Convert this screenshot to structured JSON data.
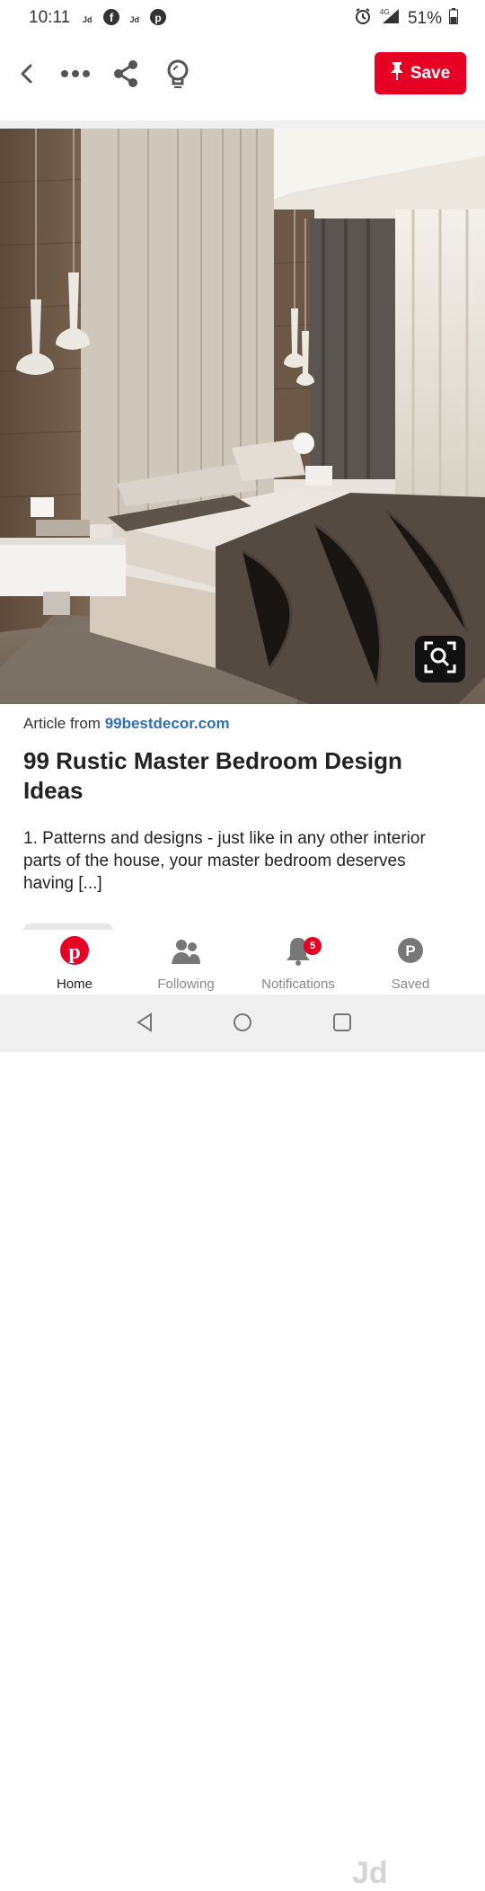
{
  "status": {
    "time": "10:11",
    "mini_labels": [
      "Jd",
      "Jd"
    ],
    "battery": "51%",
    "network": "4G",
    "icons": [
      "facebook-icon",
      "pinterest-icon",
      "alarm-icon",
      "signal-icon",
      "battery-icon"
    ]
  },
  "toolbar": {
    "save_label": "Save",
    "icons": [
      "back-arrow-icon",
      "more-icon",
      "share-icon",
      "visual-search-icon",
      "pin-icon"
    ]
  },
  "article": {
    "source_prefix": "Article from ",
    "source_domain": "99bestdecor.com",
    "title": "99 Rustic Master Bedroom Design Ideas",
    "description": "1. Patterns and designs - just like in any other interior parts of the house, your master bedroom deserves having [...]"
  },
  "nav": {
    "items": [
      {
        "label": "Home",
        "icon": "pinterest-logo-icon",
        "active": true
      },
      {
        "label": "Following",
        "icon": "people-icon",
        "active": false
      },
      {
        "label": "Notifications",
        "icon": "bell-icon",
        "active": false,
        "badge": "5"
      },
      {
        "label": "Saved",
        "icon": "profile-icon",
        "active": false,
        "avatar_letter": "P"
      }
    ],
    "watermark": "Jd"
  },
  "colors": {
    "accent": "#e60023",
    "link": "#2f6fb5",
    "text": "#222222",
    "muted": "#888888"
  }
}
